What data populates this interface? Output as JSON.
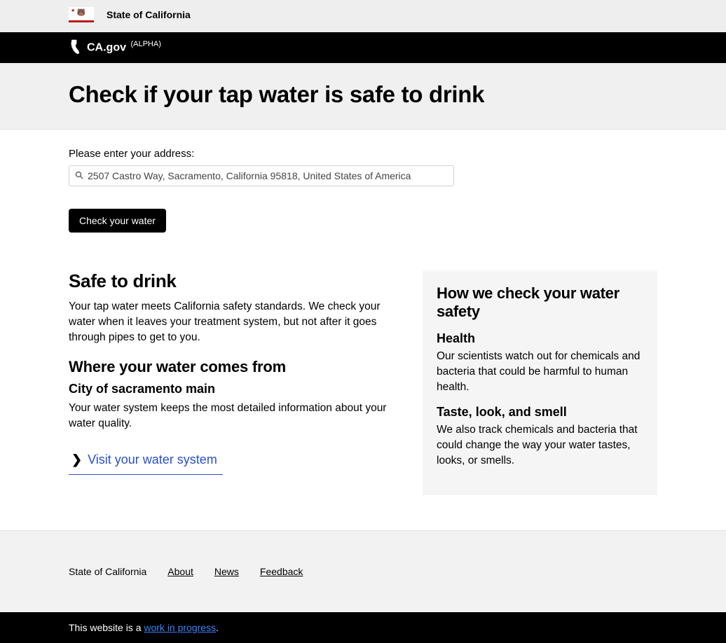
{
  "topbar": {
    "label": "State of California"
  },
  "nav": {
    "brand": "CA.gov",
    "badge": "(ALPHA)"
  },
  "title": "Check if your tap water is safe to drink",
  "form": {
    "prompt": "Please enter your address:",
    "address_value": "2507 Castro Way, Sacramento, California 95818, United States of America",
    "button_label": "Check your water"
  },
  "result": {
    "status_heading": "Safe to drink",
    "status_body": "Your tap water meets California safety standards. We check your water when it leaves your treatment system, but not after it goes through pipes to get to you.",
    "source_heading": "Where your water comes from",
    "system_name": "City of sacramento main",
    "system_body": "Your water system keeps the most detailed information about your water quality.",
    "visit_link_label": "Visit your water system"
  },
  "sidebar": {
    "heading": "How we check your water safety",
    "health_heading": "Health",
    "health_body": "Our scientists watch out for chemicals and bacteria that could be harmful to human health.",
    "taste_heading": "Taste, look, and smell",
    "taste_body": "We also track chemicals and bacteria that could change the way your water tastes, looks, or smells."
  },
  "footer": {
    "state": "State of California",
    "links": {
      "about": "About",
      "news": "News",
      "feedback": "Feedback"
    },
    "wip_prefix": "This website is a ",
    "wip_link": "work in progress",
    "wip_suffix": "."
  }
}
